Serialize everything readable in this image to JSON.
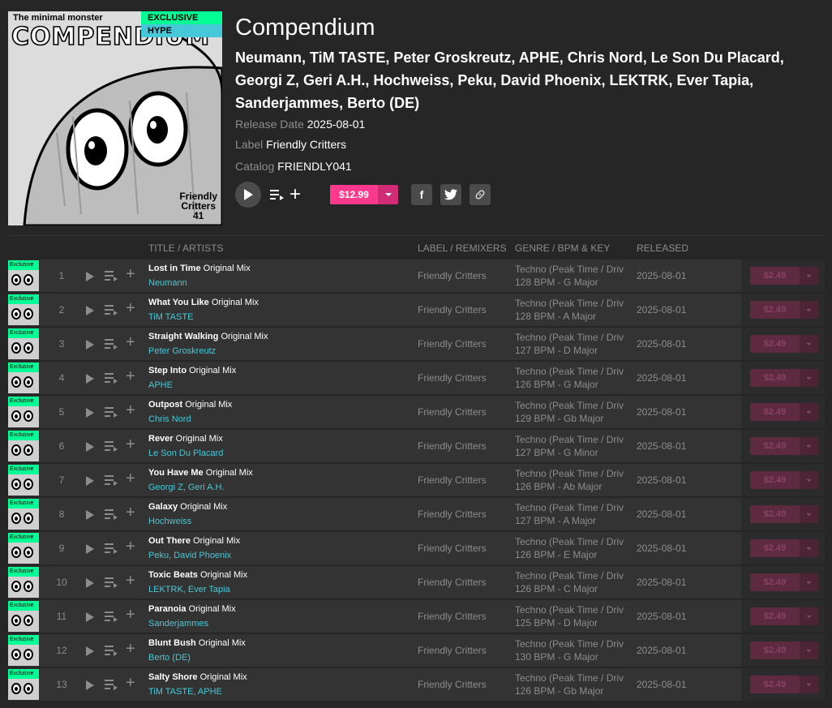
{
  "release": {
    "cover": {
      "badge_exclusive": "EXCLUSIVE",
      "badge_hype": "HYPE",
      "tagline": "The minimal monster",
      "title": "COMPENDIUM",
      "logo_line1": "Friendly",
      "logo_line2": "Critters",
      "logo_line3": "41"
    },
    "title": "Compendium",
    "artists": "Neumann, TiM TASTE, Peter Groskreutz, APHE, Chris Nord, Le Son Du Placard, Georgi Z, Geri A.H., Hochweiss, Peku, David Phoenix, LEKTRK, Ever Tapia, Sanderjammes, Berto (DE)",
    "release_date_label": "Release Date",
    "release_date": "2025-08-01",
    "label_label": "Label",
    "label": "Friendly Critters",
    "catalog_label": "Catalog",
    "catalog": "FRIENDLY041",
    "price": "$12.99"
  },
  "table": {
    "headers": {
      "title": "TITLE / ARTISTS",
      "label": "LABEL / REMIXERS",
      "genre": "GENRE / BPM & KEY",
      "released": "RELEASED"
    },
    "thumb_badge": "Exclusive",
    "tracks": [
      {
        "num": "1",
        "title": "Lost in Time",
        "mix": "Original Mix",
        "artists": "Neumann",
        "label": "Friendly Critters",
        "genre": "Techno (Peak Time / Driving)",
        "bpm_key": "128 BPM - G Major",
        "released": "2025-08-01",
        "price": "$2.49"
      },
      {
        "num": "2",
        "title": "What You Like",
        "mix": "Original Mix",
        "artists": "TiM TASTE",
        "label": "Friendly Critters",
        "genre": "Techno (Peak Time / Driving)",
        "bpm_key": "128 BPM - A Major",
        "released": "2025-08-01",
        "price": "$2.49"
      },
      {
        "num": "3",
        "title": "Straight Walking",
        "mix": "Original Mix",
        "artists": "Peter Groskreutz",
        "label": "Friendly Critters",
        "genre": "Techno (Peak Time / Driving)",
        "bpm_key": "127 BPM - D Major",
        "released": "2025-08-01",
        "price": "$2.49"
      },
      {
        "num": "4",
        "title": "Step Into",
        "mix": "Original Mix",
        "artists": "APHE",
        "label": "Friendly Critters",
        "genre": "Techno (Peak Time / Driving)",
        "bpm_key": "126 BPM - G Major",
        "released": "2025-08-01",
        "price": "$2.49"
      },
      {
        "num": "5",
        "title": "Outpost",
        "mix": "Original Mix",
        "artists": "Chris Nord",
        "label": "Friendly Critters",
        "genre": "Techno (Peak Time / Driving)",
        "bpm_key": "129 BPM - Gb Major",
        "released": "2025-08-01",
        "price": "$2.49"
      },
      {
        "num": "6",
        "title": "Rever",
        "mix": "Original Mix",
        "artists": "Le Son Du Placard",
        "label": "Friendly Critters",
        "genre": "Techno (Peak Time / Driving)",
        "bpm_key": "127 BPM - G Minor",
        "released": "2025-08-01",
        "price": "$2.49"
      },
      {
        "num": "7",
        "title": "You Have Me",
        "mix": "Original Mix",
        "artists": "Georgi Z, Geri A.H.",
        "label": "Friendly Critters",
        "genre": "Techno (Peak Time / Driving)",
        "bpm_key": "126 BPM - Ab Major",
        "released": "2025-08-01",
        "price": "$2.49"
      },
      {
        "num": "8",
        "title": "Galaxy",
        "mix": "Original Mix",
        "artists": "Hochweiss",
        "label": "Friendly Critters",
        "genre": "Techno (Peak Time / Driving)",
        "bpm_key": "127 BPM - A Major",
        "released": "2025-08-01",
        "price": "$2.49"
      },
      {
        "num": "9",
        "title": "Out There",
        "mix": "Original Mix",
        "artists": "Peku, David Phoenix",
        "label": "Friendly Critters",
        "genre": "Techno (Peak Time / Driving)",
        "bpm_key": "126 BPM - E Major",
        "released": "2025-08-01",
        "price": "$2.49"
      },
      {
        "num": "10",
        "title": "Toxic Beats",
        "mix": "Original Mix",
        "artists": "LEKTRK, Ever Tapia",
        "label": "Friendly Critters",
        "genre": "Techno (Peak Time / Driving)",
        "bpm_key": "126 BPM - C Major",
        "released": "2025-08-01",
        "price": "$2.49"
      },
      {
        "num": "11",
        "title": "Paranoia",
        "mix": "Original Mix",
        "artists": "Sanderjammes",
        "label": "Friendly Critters",
        "genre": "Techno (Peak Time / Driving)",
        "bpm_key": "125 BPM - D Major",
        "released": "2025-08-01",
        "price": "$2.49"
      },
      {
        "num": "12",
        "title": "Blunt Bush",
        "mix": "Original Mix",
        "artists": "Berto (DE)",
        "label": "Friendly Critters",
        "genre": "Techno (Peak Time / Driving)",
        "bpm_key": "130 BPM - G Major",
        "released": "2025-08-01",
        "price": "$2.49"
      },
      {
        "num": "13",
        "title": "Salty Shore",
        "mix": "Original Mix",
        "artists": "TiM TASTE, APHE",
        "label": "Friendly Critters",
        "genre": "Techno (Peak Time / Driving)",
        "bpm_key": "126 BPM - Gb Major",
        "released": "2025-08-01",
        "price": "$2.49"
      }
    ]
  },
  "icons": {
    "play": "play-icon",
    "queue": "add-to-queue-icon",
    "add": "plus-icon",
    "dropdown": "chevron-down-icon",
    "facebook": "facebook-icon",
    "twitter": "twitter-icon",
    "link": "link-icon"
  },
  "colors": {
    "background": "#262626",
    "row": "#333333",
    "accent_pink": "#ff3a8c",
    "accent_cyan": "#46c8d9",
    "accent_green": "#01ff95",
    "muted_text": "#8c8c8c"
  }
}
